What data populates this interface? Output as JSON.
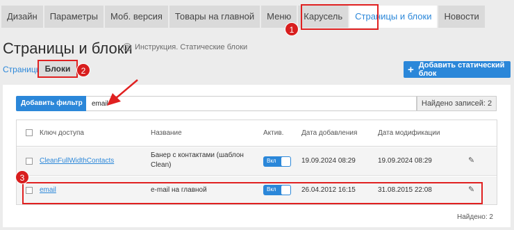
{
  "tabs": [
    {
      "label": "Дизайн"
    },
    {
      "label": "Параметры"
    },
    {
      "label": "Моб. версия"
    },
    {
      "label": "Товары на главной"
    },
    {
      "label": "Меню"
    },
    {
      "label": "Карусель"
    },
    {
      "label": "Страницы и блоки",
      "active": true
    },
    {
      "label": "Новости"
    }
  ],
  "page": {
    "title": "Страницы и блоки",
    "help_text": "Инструкция. Статические блоки"
  },
  "subnav": {
    "pages": "Страницы",
    "blocks": "Блоки"
  },
  "add_static_button": "Добавить статический блок",
  "filter": {
    "button_label": "Добавить фильтр",
    "value": "email",
    "found_label": "Найдено записей: 2"
  },
  "table": {
    "headers": {
      "key": "Ключ доступа",
      "name": "Название",
      "active": "Актив.",
      "created": "Дата добавления",
      "modified": "Дата модификации"
    },
    "rows": [
      {
        "key": "CleanFullWidthContacts",
        "name_line1": "Банер с контактами (шаблон",
        "name_line2": "Clean)",
        "toggle": "Вкл",
        "created": "19.09.2024 08:29",
        "modified": "19.09.2024 08:29"
      },
      {
        "key": "email",
        "name_line1": "e-mail на главной",
        "toggle": "Вкл",
        "created": "26.04.2012 16:15",
        "modified": "31.08.2015 22:08"
      }
    ]
  },
  "found_bottom": "Найдено: 2",
  "annotations": [
    "1",
    "2",
    "3"
  ],
  "colors": {
    "accent": "#2b87d9",
    "highlight": "#e02020",
    "badge": "#d81e1e"
  }
}
